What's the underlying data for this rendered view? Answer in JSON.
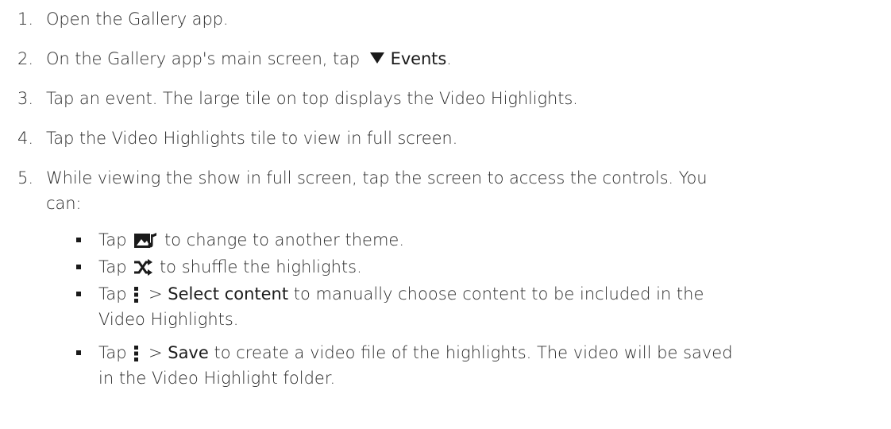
{
  "steps": [
    {
      "num": "1",
      "text": "Open the Gallery app."
    },
    {
      "num": "2",
      "prefix": "On the Gallery app's main screen, tap",
      "icon": "triangle-down-icon",
      "bold": "Events",
      "suffix": "."
    },
    {
      "num": "3",
      "text": "Tap an event. The large tile on top displays the Video Highlights."
    },
    {
      "num": "4",
      "text": "Tap the Video Highlights tile to view in full screen."
    },
    {
      "num": "5",
      "line1": "While viewing the show in full screen, tap the screen to access the controls. You",
      "line2": "can:"
    }
  ],
  "bullets": [
    {
      "prefix": "Tap",
      "icon": "theme-music-icon",
      "suffix": "to change to another theme."
    },
    {
      "prefix": "Tap",
      "icon": "shuffle-icon",
      "suffix": "to shuffle the highlights."
    },
    {
      "prefix": "Tap",
      "icon": "more-vertical-icon",
      "sep": ">",
      "bold": "Select content",
      "line1_suffix": "to manually choose content to be included in the",
      "line2": "Video Highlights."
    },
    {
      "prefix": "Tap",
      "icon": "more-vertical-icon",
      "sep": ">",
      "bold": "Save",
      "line1_suffix": "to create a video file of the highlights. The video will be saved",
      "line2": "in the Video Highlight folder."
    }
  ],
  "colors": {
    "text": "#2b2b2b",
    "bold": "#1a1a1a",
    "background": "#ffffff"
  }
}
